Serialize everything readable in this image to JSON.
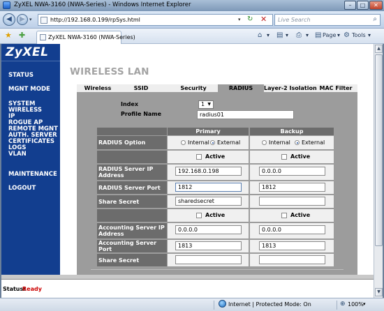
{
  "window": {
    "title": "ZyXEL NWA-3160 (NWA-Series) - Windows Internet Explorer",
    "min_glyph": "–",
    "max_glyph": "□",
    "close_glyph": "✕"
  },
  "browser": {
    "back_glyph": "◀",
    "forward_glyph": "▶",
    "dropdown_glyph": "▾",
    "url": "http://192.168.0.199/rpSys.html",
    "refresh_glyph": "↻",
    "stop_glyph": "✕",
    "search_placeholder": "Live Search",
    "search_glyph": "⌕",
    "tab_title": "ZyXEL NWA-3160 (NWA-Series)",
    "home_glyph": "⌂",
    "feeds_glyph": "▤",
    "print_glyph": "⎙",
    "page_menu": "Page",
    "tools_menu": "Tools",
    "fav_glyph": "★",
    "add_fav_glyph": "✚"
  },
  "logo": "ZyXEL",
  "nav": [
    "STATUS",
    "MGNT MODE",
    "SYSTEM",
    "WIRELESS",
    "IP",
    "ROGUE AP",
    "REMOTE MGNT",
    "AUTH. SERVER",
    "CERTIFICATES",
    "LOGS",
    "VLAN",
    "MAINTENANCE",
    "LOGOUT"
  ],
  "page_title": "WIRELESS LAN",
  "tabs": [
    "Wireless",
    "SSID",
    "Security",
    "RADIUS",
    "Layer-2 Isolation",
    "MAC Filter"
  ],
  "active_tab": "RADIUS",
  "form": {
    "index_label": "Index",
    "index_value": "1",
    "profile_label": "Profile Name",
    "profile_value": "radius01"
  },
  "table": {
    "primary_header": "Primary",
    "backup_header": "Backup",
    "radius_option_label": "RADIUS Option",
    "internal_label": "Internal",
    "external_label": "External",
    "primary_option": "External",
    "backup_option": "External",
    "active_label": "Active",
    "radius_ip_label": "RADIUS Server IP Address",
    "radius_port_label": "RADIUS Server Port",
    "share_secret_label": "Share Secret",
    "acct_ip_label": "Accounting Server IP Address",
    "acct_port_label": "Accounting Server Port",
    "acct_secret_label": "Share Secret",
    "primary": {
      "radius_ip": "192.168.0.198",
      "radius_port": "1812",
      "share_secret": "sharedsecret",
      "acct_ip": "0.0.0.0",
      "acct_port": "1813",
      "acct_secret": ""
    },
    "backup": {
      "radius_ip": "0.0.0.0",
      "radius_port": "1812",
      "share_secret": "",
      "acct_ip": "0.0.0.0",
      "acct_port": "1813",
      "acct_secret": ""
    }
  },
  "status": {
    "label": "Status:",
    "value": "Ready"
  },
  "ie_status": {
    "zone": "Internet | Protected Mode: On",
    "zoom": "100%"
  },
  "colors": {
    "nav_bg": "#123e8f",
    "panel_bg": "#9c9c9c",
    "header_bg": "#6c6c6c",
    "status_ready": "#cc0000",
    "page_title": "#a3a3a3"
  }
}
